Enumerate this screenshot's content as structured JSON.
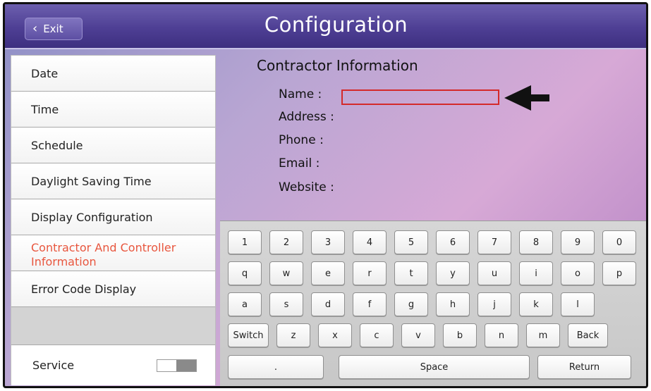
{
  "header": {
    "exit_label": "Exit",
    "title": "Configuration"
  },
  "sidebar": {
    "items": [
      {
        "label": "Date"
      },
      {
        "label": "Time"
      },
      {
        "label": "Schedule"
      },
      {
        "label": "Daylight Saving Time"
      },
      {
        "label": "Display Configuration"
      },
      {
        "label": "Contractor And Controller Information",
        "active": true
      },
      {
        "label": "Error Code Display"
      }
    ],
    "service_label": "Service",
    "service_toggle": "on"
  },
  "contractor": {
    "title": "Contractor Information",
    "name_label": "Name :",
    "address_label": "Address :",
    "phone_label": "Phone :",
    "email_label": "Email :",
    "website_label": "Website :",
    "name_value": ""
  },
  "keyboard": {
    "row1": [
      "1",
      "2",
      "3",
      "4",
      "5",
      "6",
      "7",
      "8",
      "9",
      "0"
    ],
    "row2": [
      "q",
      "w",
      "e",
      "r",
      "t",
      "y",
      "u",
      "i",
      "o",
      "p"
    ],
    "row3": [
      "a",
      "s",
      "d",
      "f",
      "g",
      "h",
      "j",
      "k",
      "l"
    ],
    "row4": [
      "Switch",
      "z",
      "x",
      "c",
      "v",
      "b",
      "n",
      "m",
      "Back"
    ],
    "period": ".",
    "space": "Space",
    "return": "Return"
  },
  "colors": {
    "active_item": "#e8563e",
    "input_border": "#d42a2a",
    "header": "#4e3f94"
  }
}
